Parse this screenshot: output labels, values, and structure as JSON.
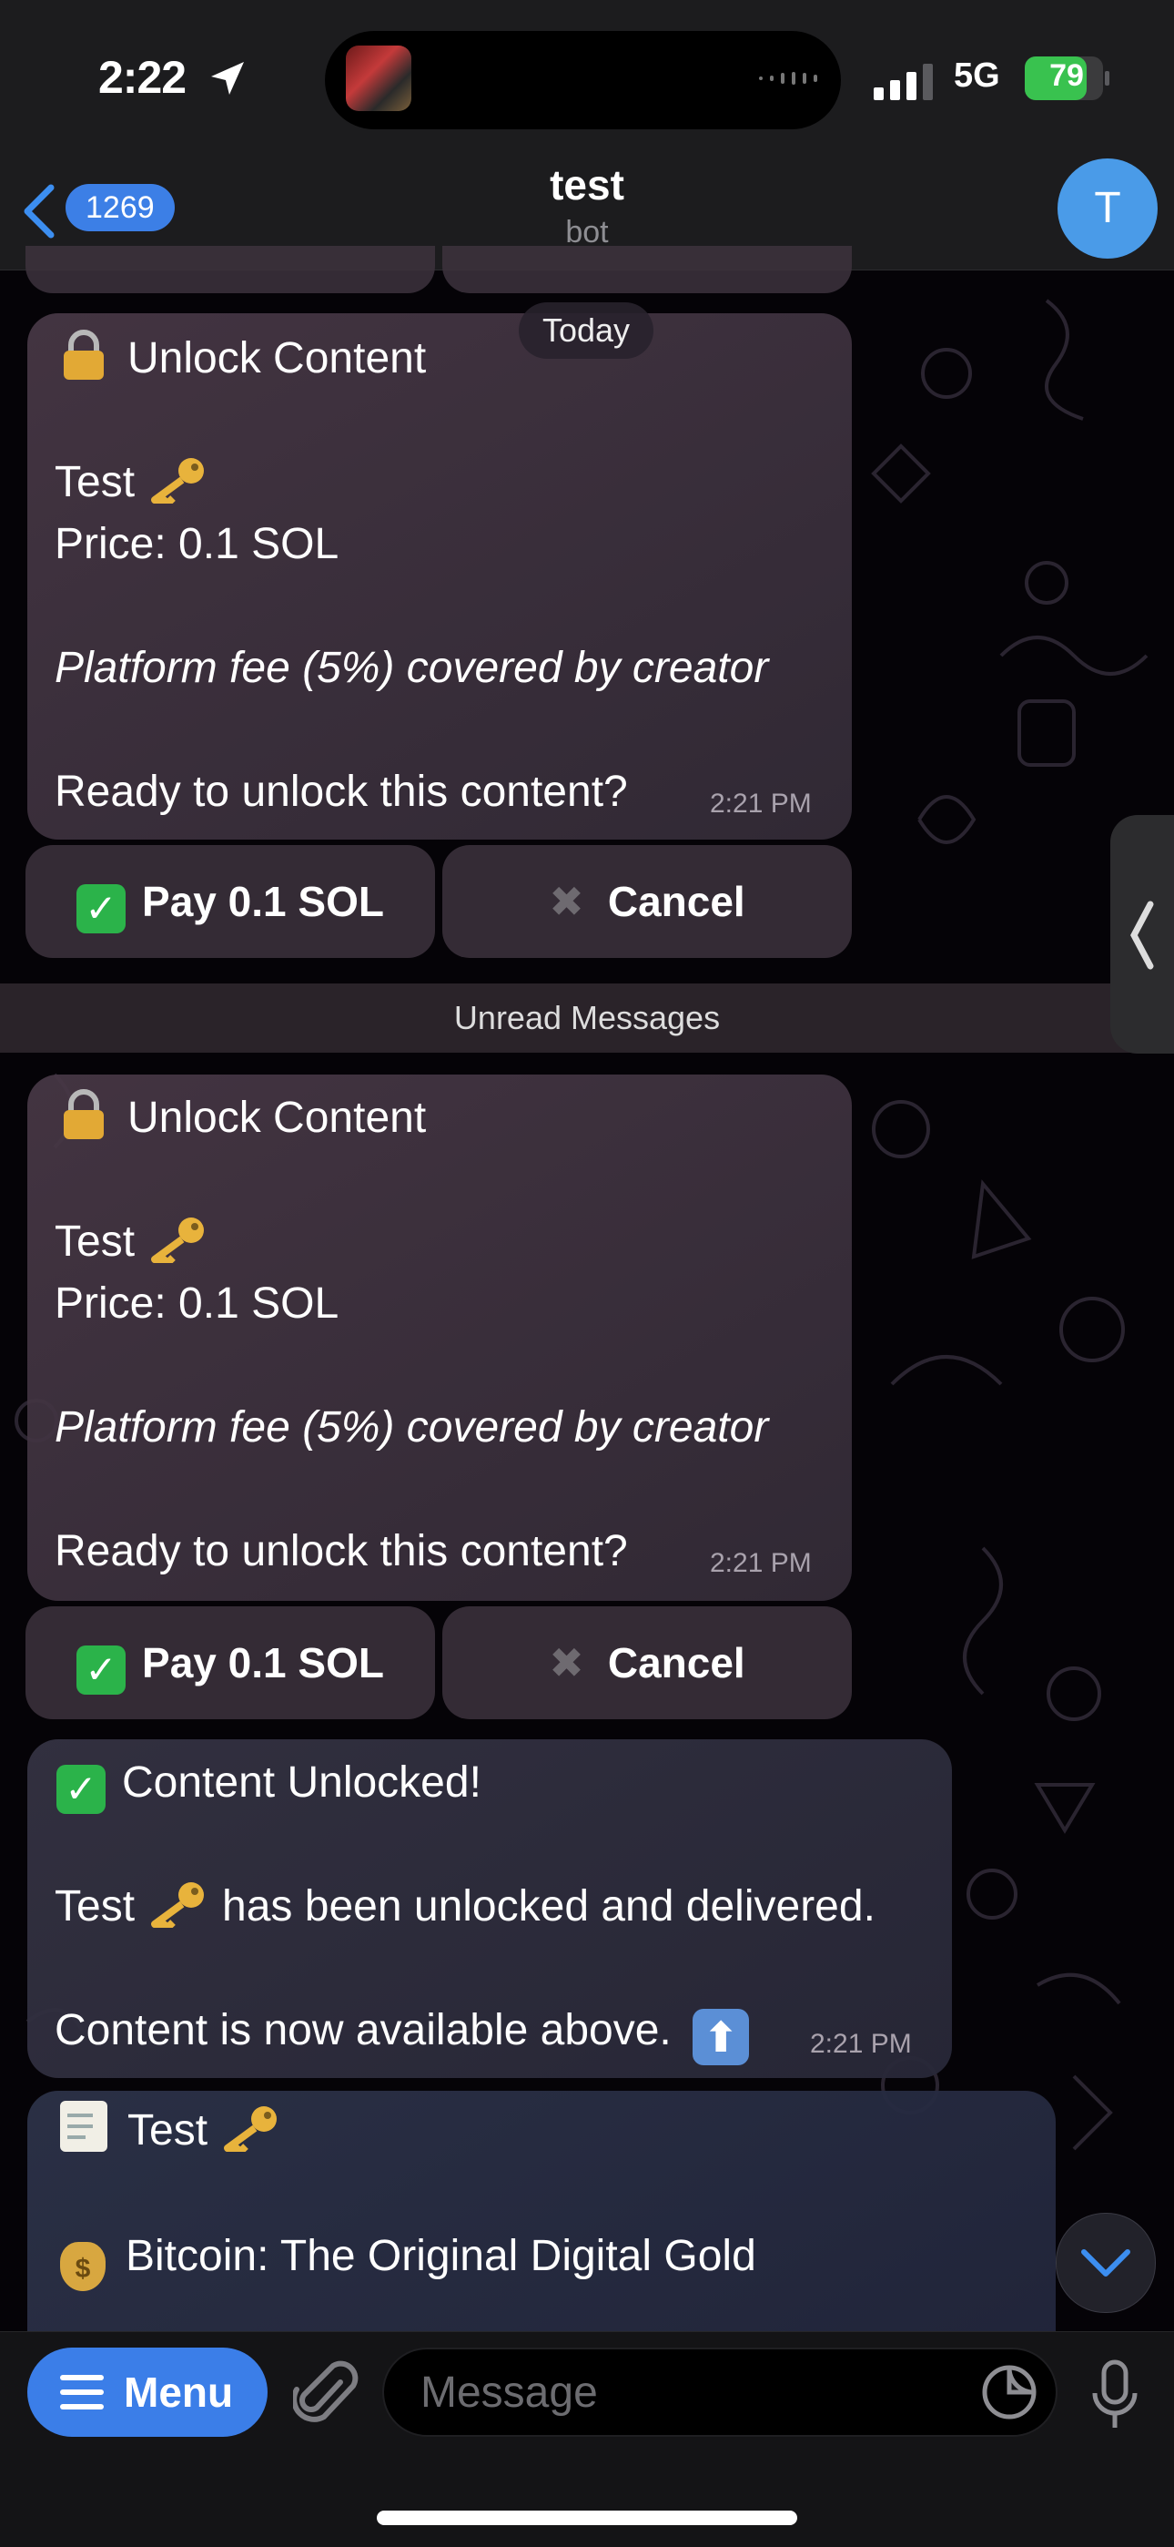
{
  "status_bar": {
    "time": "2:22",
    "network": "5G",
    "battery": "79"
  },
  "header": {
    "back_count": "1269",
    "title": "test",
    "subtitle": "bot",
    "avatar_letter": "T"
  },
  "date_label": "Today",
  "unread_label": "Unread Messages",
  "messages": [
    {
      "title": "Unlock Content",
      "item": "Test",
      "price": "Price: 0.1 SOL",
      "fee_note": "Platform fee (5%) covered by creator",
      "question": "Ready to unlock this content?",
      "time": "2:21 PM",
      "buttons": [
        "Pay 0.1 SOL",
        "Cancel"
      ]
    },
    {
      "title": "Unlock Content",
      "item": "Test",
      "price": "Price: 0.1 SOL",
      "fee_note": "Platform fee (5%) covered by creator",
      "question": "Ready to unlock this content?",
      "time": "2:21 PM",
      "buttons": [
        "Pay 0.1 SOL",
        "Cancel"
      ]
    },
    {
      "title": "Content Unlocked!",
      "line1_before": "Test",
      "line1_after": "has been unlocked and delivered.",
      "line2": "Content is now available above.",
      "time": "2:21 PM"
    },
    {
      "title": "Test",
      "line1": "Bitcoin: The Original Digital Gold"
    }
  ],
  "input": {
    "menu_label": "Menu",
    "placeholder": "Message"
  },
  "icons": [
    "location-arrow-icon",
    "signal-icon",
    "battery-icon",
    "back-chevron-icon",
    "lock-icon",
    "key-icon",
    "check-mark-icon",
    "cross-icon",
    "up-arrow-icon",
    "memo-icon",
    "money-bag-icon",
    "menu-icon",
    "paperclip-icon",
    "sticker-icon",
    "microphone-icon",
    "chevron-down-icon"
  ],
  "colors": {
    "accent": "#3b7ee8",
    "check_green": "#2bb34a",
    "bubble": "#3f323f"
  }
}
